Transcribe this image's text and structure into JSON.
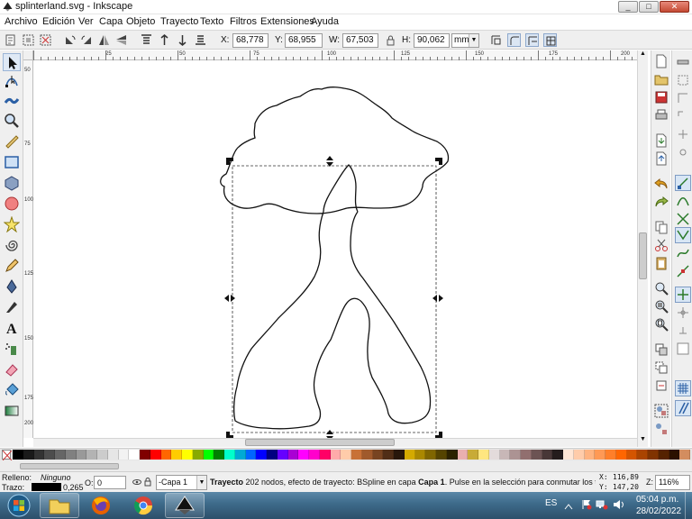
{
  "window": {
    "title": "splinterland.svg - Inkscape",
    "minimize": "_",
    "maximize": "□",
    "close": "✕"
  },
  "menu": [
    "Archivo",
    "Edición",
    "Ver",
    "Capa",
    "Objeto",
    "Trayecto",
    "Texto",
    "Filtros",
    "Extensiones",
    "Ayuda"
  ],
  "toolbar": {
    "x_label": "X:",
    "x_value": "68,778",
    "y_label": "Y:",
    "y_value": "68,955",
    "w_label": "W:",
    "w_value": "67,503",
    "lock_icon": "lock-icon",
    "h_label": "H:",
    "h_value": "90,062",
    "units": "mm"
  },
  "ruler": {
    "h_ticks": [
      "25",
      "50",
      "75",
      "100",
      "125",
      "150",
      "175",
      "200"
    ],
    "v_ticks": [
      "50",
      "75",
      "100",
      "125",
      "150",
      "175",
      "200"
    ]
  },
  "palette": {
    "swatches": [
      "#000000",
      "#1a1a1a",
      "#333333",
      "#4d4d4d",
      "#666666",
      "#808080",
      "#999999",
      "#b3b3b3",
      "#cccccc",
      "#e6e6e6",
      "#f2f2f2",
      "#ffffff",
      "#800000",
      "#ff0000",
      "#ff6600",
      "#ffcc00",
      "#ffff00",
      "#88aa00",
      "#00ff00",
      "#008000",
      "#00ffcc",
      "#00aad4",
      "#0066ff",
      "#0000ff",
      "#000080",
      "#6600ff",
      "#aa00d4",
      "#ff00ff",
      "#ff00cc",
      "#ff0066",
      "#ffaaaa",
      "#ffccaa",
      "#c87137",
      "#a05a2c",
      "#784421",
      "#502d16",
      "#28170b",
      "#d4aa00",
      "#aa8800",
      "#806600",
      "#554400",
      "#2b2200",
      "#e9afaf",
      "#c8ab37",
      "#ffe680",
      "#e3dbdb",
      "#c8b7b7",
      "#ac9393",
      "#916f6f",
      "#6c5353",
      "#483737",
      "#241c1c",
      "#ffe6d5",
      "#ffccaa",
      "#ffb380",
      "#ff9955",
      "#ff7f2a",
      "#ff6600",
      "#d45500",
      "#aa4400",
      "#803300",
      "#552200",
      "#2b1100",
      "#d38d5f"
    ]
  },
  "status": {
    "fill_label": "Relleno:",
    "fill_value": "Ninguno",
    "stroke_label": "Trazo:",
    "stroke_width": "0,265",
    "opacity_label": "O:",
    "opacity_value": "0",
    "layer": "-Capa 1",
    "message_bold": "Trayecto",
    "message": " 202 nodos, efecto de trayecto: BSpline en capa ",
    "message_layer": "Capa 1",
    "message_tail": ". Pulse en la selección para conmutar los tir...",
    "cursor_x_label": "X:",
    "cursor_x": "116,89",
    "cursor_y_label": "Y:",
    "cursor_y": "147,20",
    "zoom_label": "Z:",
    "zoom": "116%"
  },
  "taskbar": {
    "apps": [
      "file-explorer-icon",
      "firefox-icon",
      "chrome-icon",
      "inkscape-icon"
    ],
    "lang": "ES",
    "time": "05:04 p.m.",
    "date": "28/02/2022"
  }
}
